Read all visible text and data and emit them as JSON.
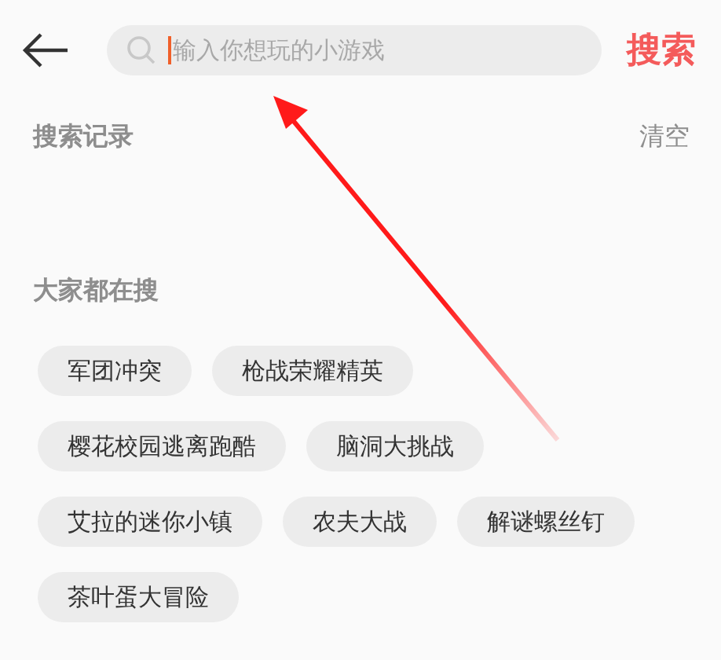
{
  "search": {
    "placeholder": "输入你想玩的小游戏",
    "button": "搜索"
  },
  "history": {
    "title": "搜索记录",
    "clear": "清空"
  },
  "popular": {
    "title": "大家都在搜",
    "tags": [
      "军团冲突",
      "枪战荣耀精英",
      "樱花校园逃离跑酷",
      "脑洞大挑战",
      "艾拉的迷你小镇",
      "农夫大战",
      "解谜螺丝钉",
      "茶叶蛋大冒险"
    ]
  }
}
